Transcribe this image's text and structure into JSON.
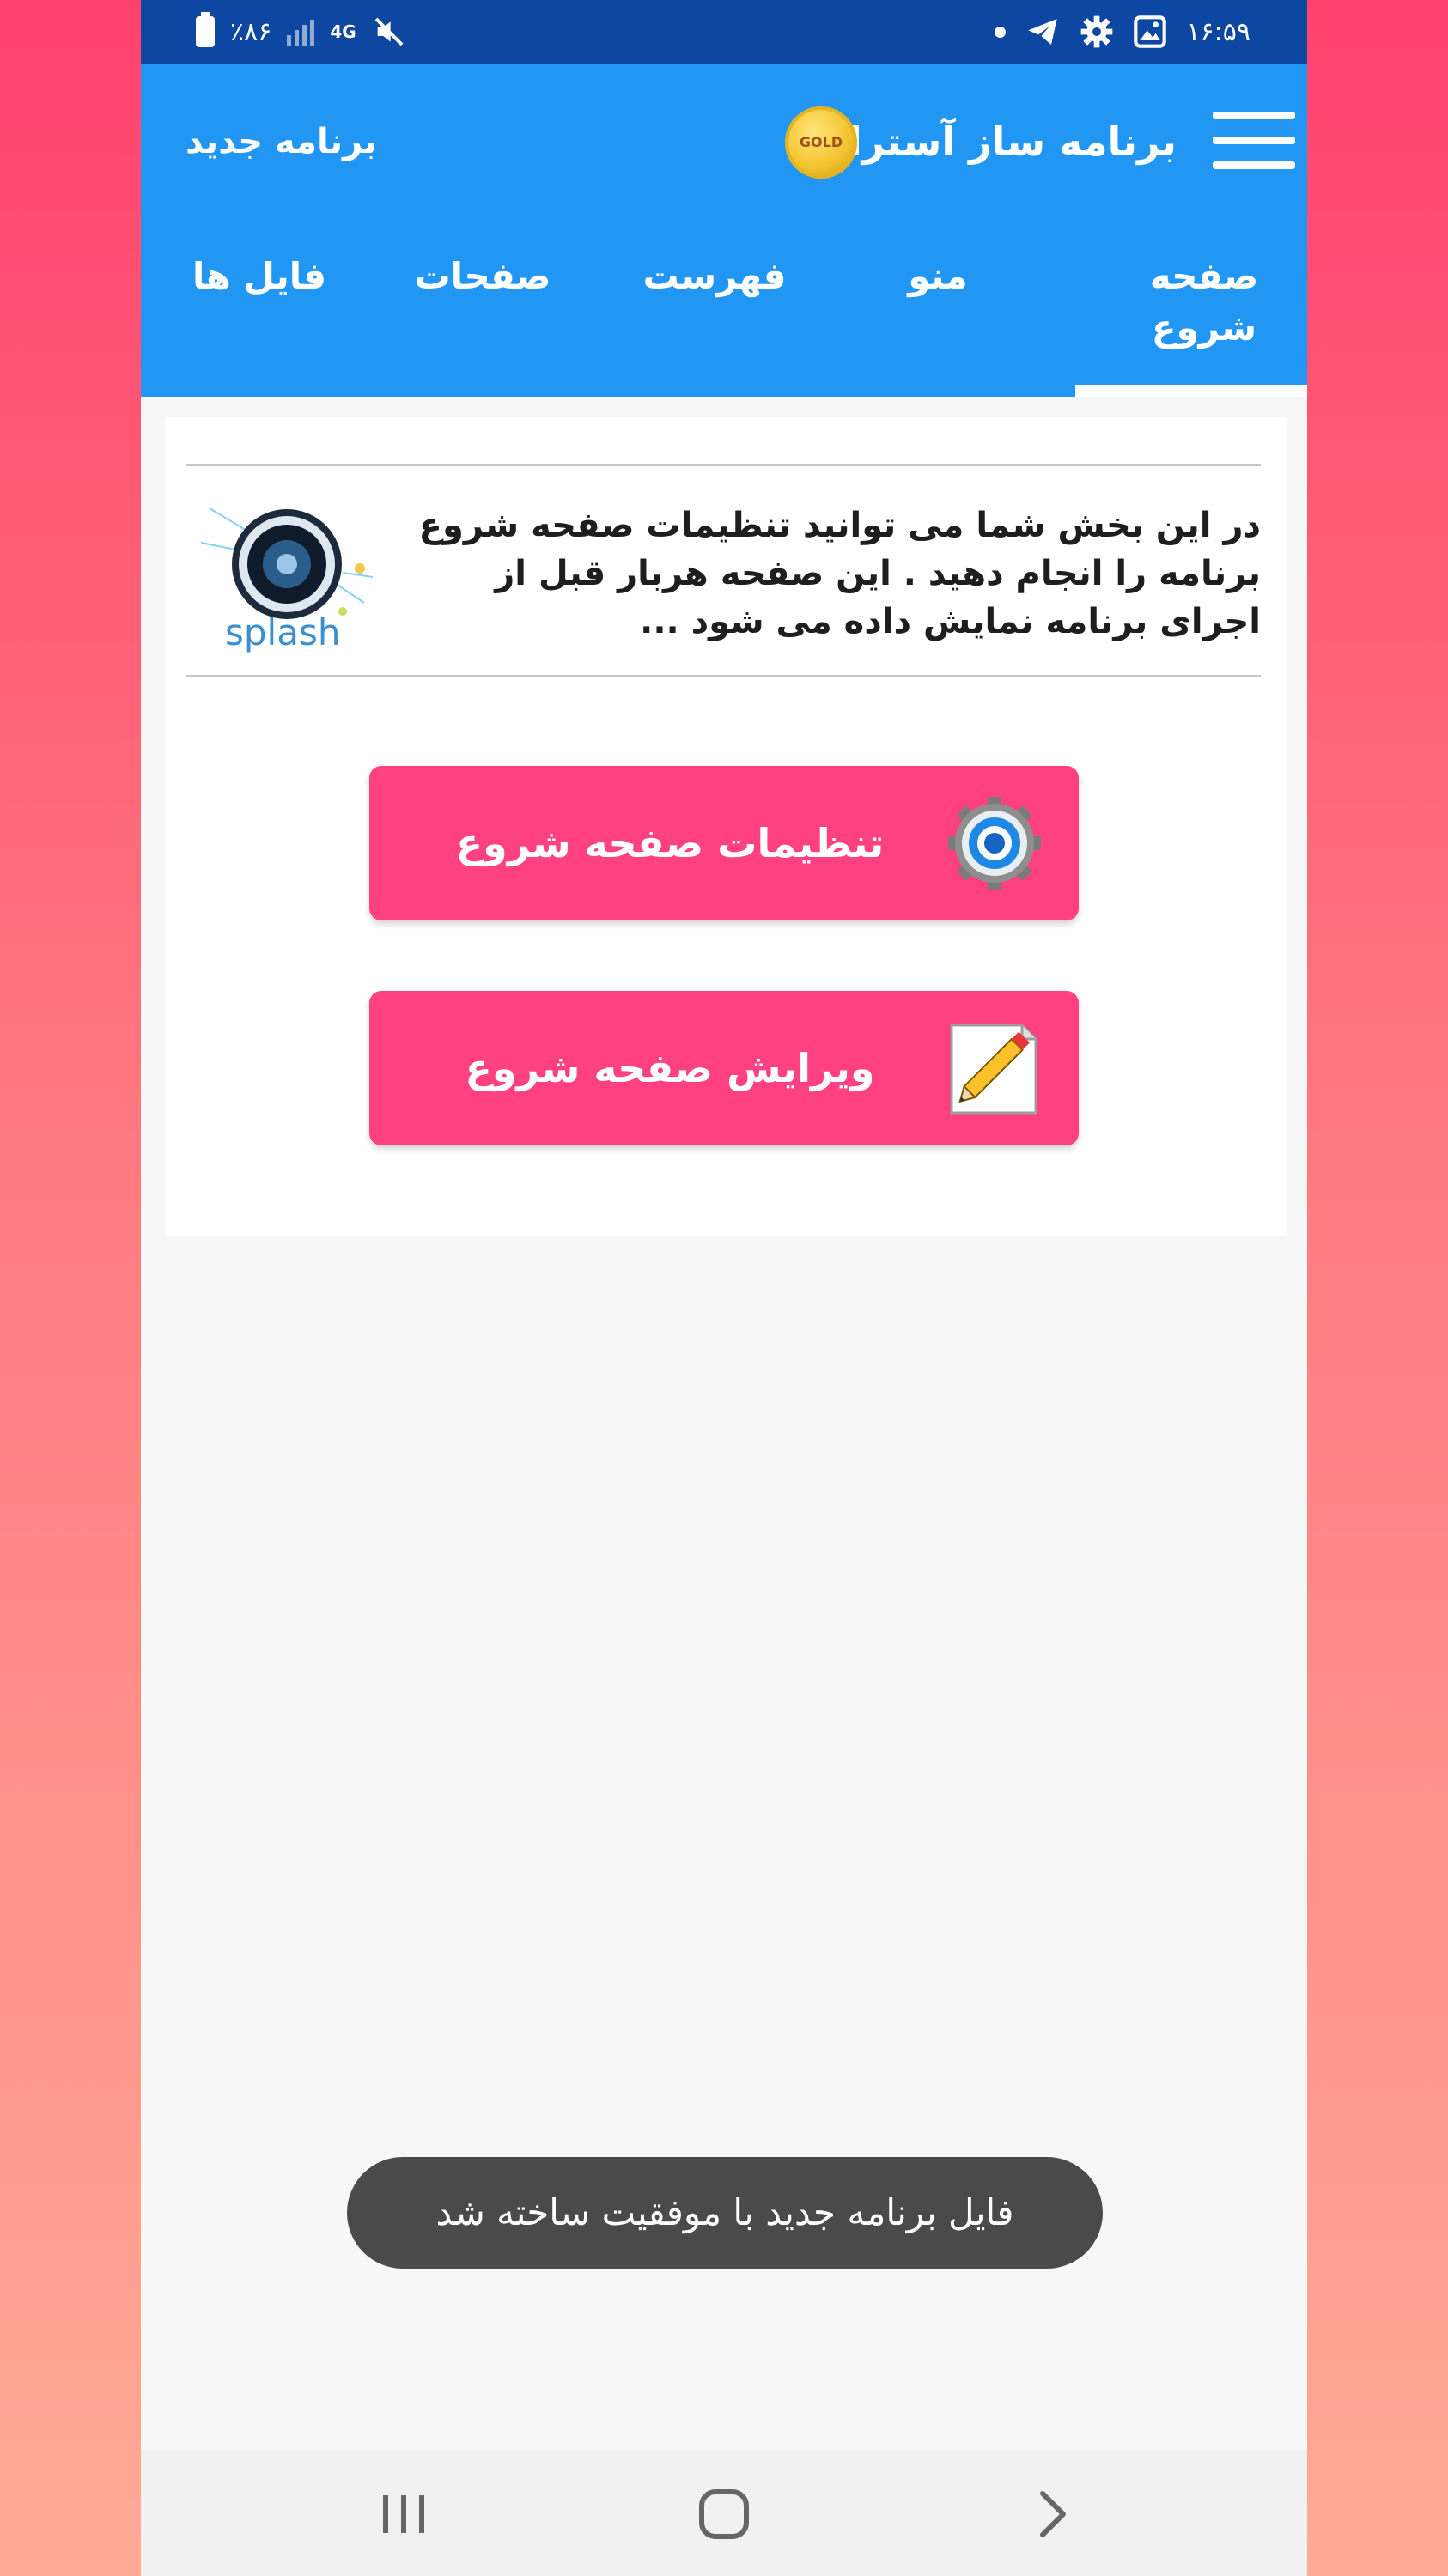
{
  "status_bar": {
    "time": "۱۶:۵۹",
    "battery_percent": "٪۸۶",
    "network": "4G",
    "icons": [
      "battery-icon",
      "signal-icon",
      "network-4g-icon",
      "mute-icon",
      "gallery-icon",
      "settings-icon",
      "telegram-icon",
      "notification-dot-icon"
    ]
  },
  "app_bar": {
    "title": "برنامه ساز آسترا",
    "badge": "GOLD",
    "new_program": "برنامه جدید"
  },
  "tabs": [
    {
      "label": "صفحه شروع",
      "selected": true
    },
    {
      "label": "منو",
      "selected": false
    },
    {
      "label": "فهرست",
      "selected": false
    },
    {
      "label": "صفحات",
      "selected": false
    },
    {
      "label": "فایل ها",
      "selected": false
    }
  ],
  "intro": {
    "text": "در این بخش شما می توانید تنظیمات صفحه شروع برنامه را انجام دهید . این صفحه هربار قبل از اجرای برنامه نمایش داده می شود ...",
    "image_text": "splash"
  },
  "buttons": {
    "settings_label": "تنظیمات صفحه شروع",
    "edit_label": "ویرایش صفحه شروع"
  },
  "toast": "فایل برنامه جدید با موفقیت ساخته شد",
  "colors": {
    "status_bar": "#0d47a1",
    "app_bar": "#2196f3",
    "button": "#ff4081",
    "toast": "#4a4a4a"
  }
}
